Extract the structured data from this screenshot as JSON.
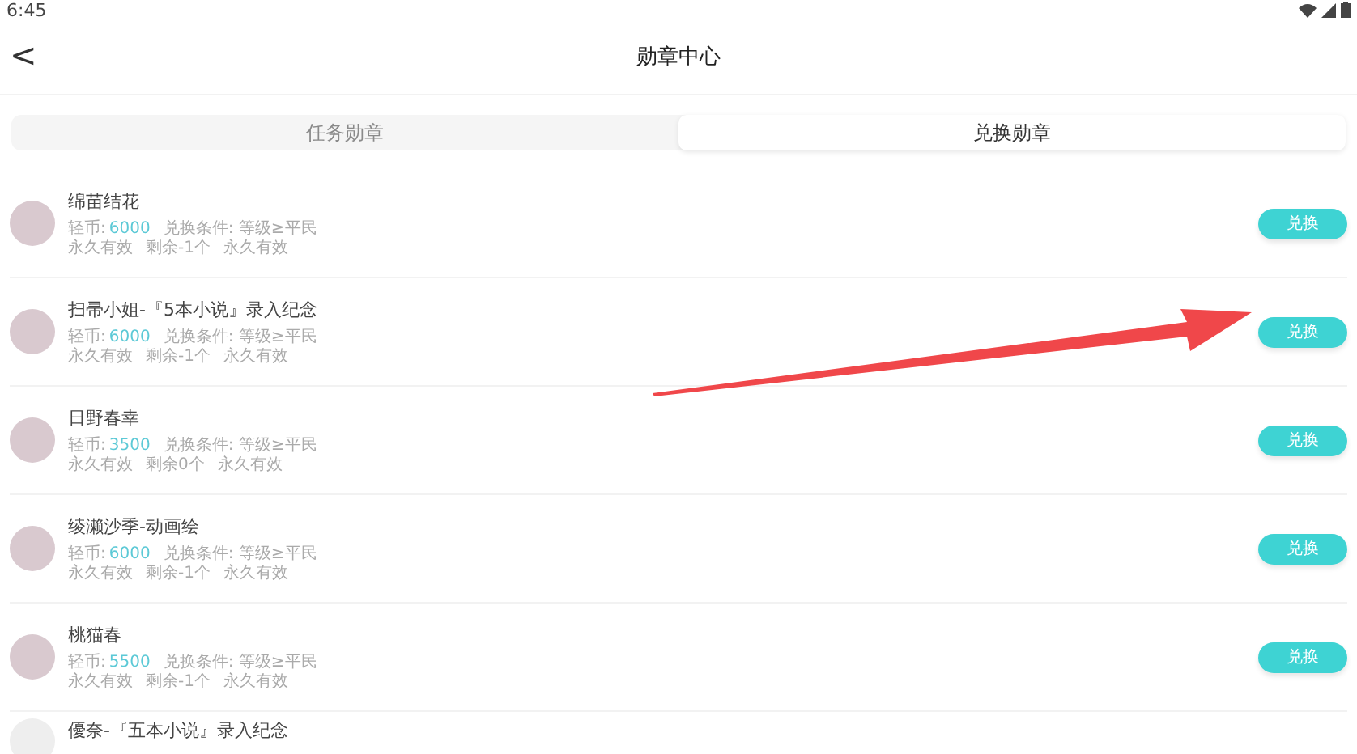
{
  "status_bar": {
    "time": "6:45"
  },
  "header": {
    "back": "<",
    "title": "勋章中心"
  },
  "tabs": [
    {
      "label": "任务勋章",
      "selected": false
    },
    {
      "label": "兑换勋章",
      "selected": true
    }
  ],
  "badges": [
    {
      "kind": "full",
      "name": "绵苗结花",
      "coin_label": "轻币:",
      "coin": "6000",
      "condition": "兑换条件: 等级≥平民",
      "validity": "永久有效",
      "remaining": "剩余-1个",
      "duration": "永久有效",
      "button": "兑换"
    },
    {
      "kind": "full",
      "name": "扫帚小姐-『5本小说』录入纪念",
      "coin_label": "轻币:",
      "coin": "6000",
      "condition": "兑换条件: 等级≥平民",
      "validity": "永久有效",
      "remaining": "剩余-1个",
      "duration": "永久有效",
      "button": "兑换"
    },
    {
      "kind": "full",
      "name": "日野春幸",
      "coin_label": "轻币:",
      "coin": "3500",
      "condition": "兑换条件: 等级≥平民",
      "validity": "永久有效",
      "remaining": "剩余0个",
      "duration": "永久有效",
      "button": "兑换"
    },
    {
      "kind": "full",
      "name": "绫濑沙季-动画绘",
      "coin_label": "轻币:",
      "coin": "6000",
      "condition": "兑换条件: 等级≥平民",
      "validity": "永久有效",
      "remaining": "剩余-1个",
      "duration": "永久有效",
      "button": "兑换"
    },
    {
      "kind": "full",
      "name": "桃猫春",
      "coin_label": "轻币:",
      "coin": "5500",
      "condition": "兑换条件: 等级≥平民",
      "validity": "永久有效",
      "remaining": "剩余-1个",
      "duration": "永久有效",
      "button": "兑换"
    },
    {
      "kind": "partial",
      "name": "優奈-『五本小说』录入纪念"
    }
  ]
}
